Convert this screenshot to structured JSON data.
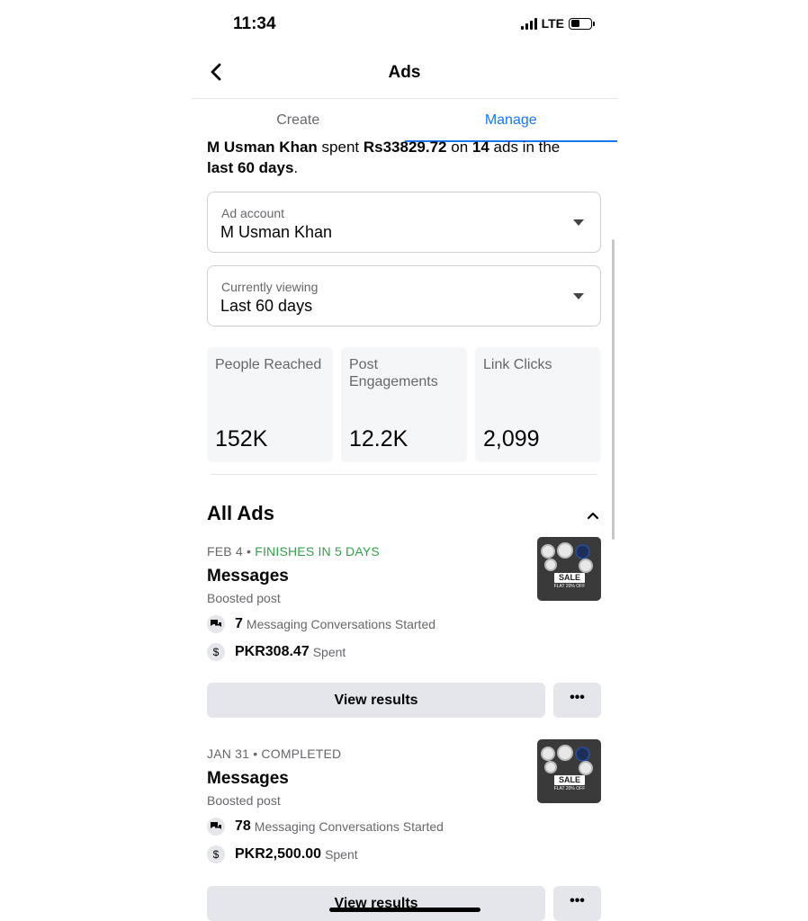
{
  "status_bar": {
    "time": "11:34",
    "network": "LTE"
  },
  "header": {
    "title": "Ads"
  },
  "tabs": [
    {
      "label": "Create",
      "active": false
    },
    {
      "label": "Manage",
      "active": true
    }
  ],
  "summary": {
    "name": "M Usman Khan",
    "spent_word": "spent",
    "amount": "Rs33829.72",
    "on_word": "on",
    "ad_count": "14",
    "ads_in_the": "ads in the",
    "period": "last 60 days",
    "period_suffix": "."
  },
  "ad_account": {
    "label": "Ad account",
    "value": "M Usman Khan"
  },
  "currently_viewing": {
    "label": "Currently viewing",
    "value": "Last 60 days"
  },
  "stats": [
    {
      "label": "People Reached",
      "value": "152K"
    },
    {
      "label": "Post Engagements",
      "value": "12.2K"
    },
    {
      "label": "Link Clicks",
      "value": "2,099"
    }
  ],
  "all_ads": {
    "title": "All Ads",
    "ads": [
      {
        "date": "FEB 4",
        "status": "FINISHES IN 5 DAYS",
        "status_color": "#31a24c",
        "title": "Messages",
        "type": "Boosted post",
        "result_count": "7",
        "result_label": "Messaging Conversations Started",
        "spent_amount": "PKR308.47",
        "spent_label": "Spent",
        "thumb_sale": "SALE",
        "thumb_flat": "FLAT 20% OFF",
        "view_label": "View results",
        "more_label": "•••"
      },
      {
        "date": "JAN 31",
        "status": "COMPLETED",
        "status_color": "#65676b",
        "title": "Messages",
        "type": "Boosted post",
        "result_count": "78",
        "result_label": "Messaging Conversations Started",
        "spent_amount": "PKR2,500.00",
        "spent_label": "Spent",
        "thumb_sale": "SALE",
        "thumb_flat": "FLAT 20% OFF",
        "view_label": "View results",
        "more_label": "•••"
      }
    ]
  }
}
